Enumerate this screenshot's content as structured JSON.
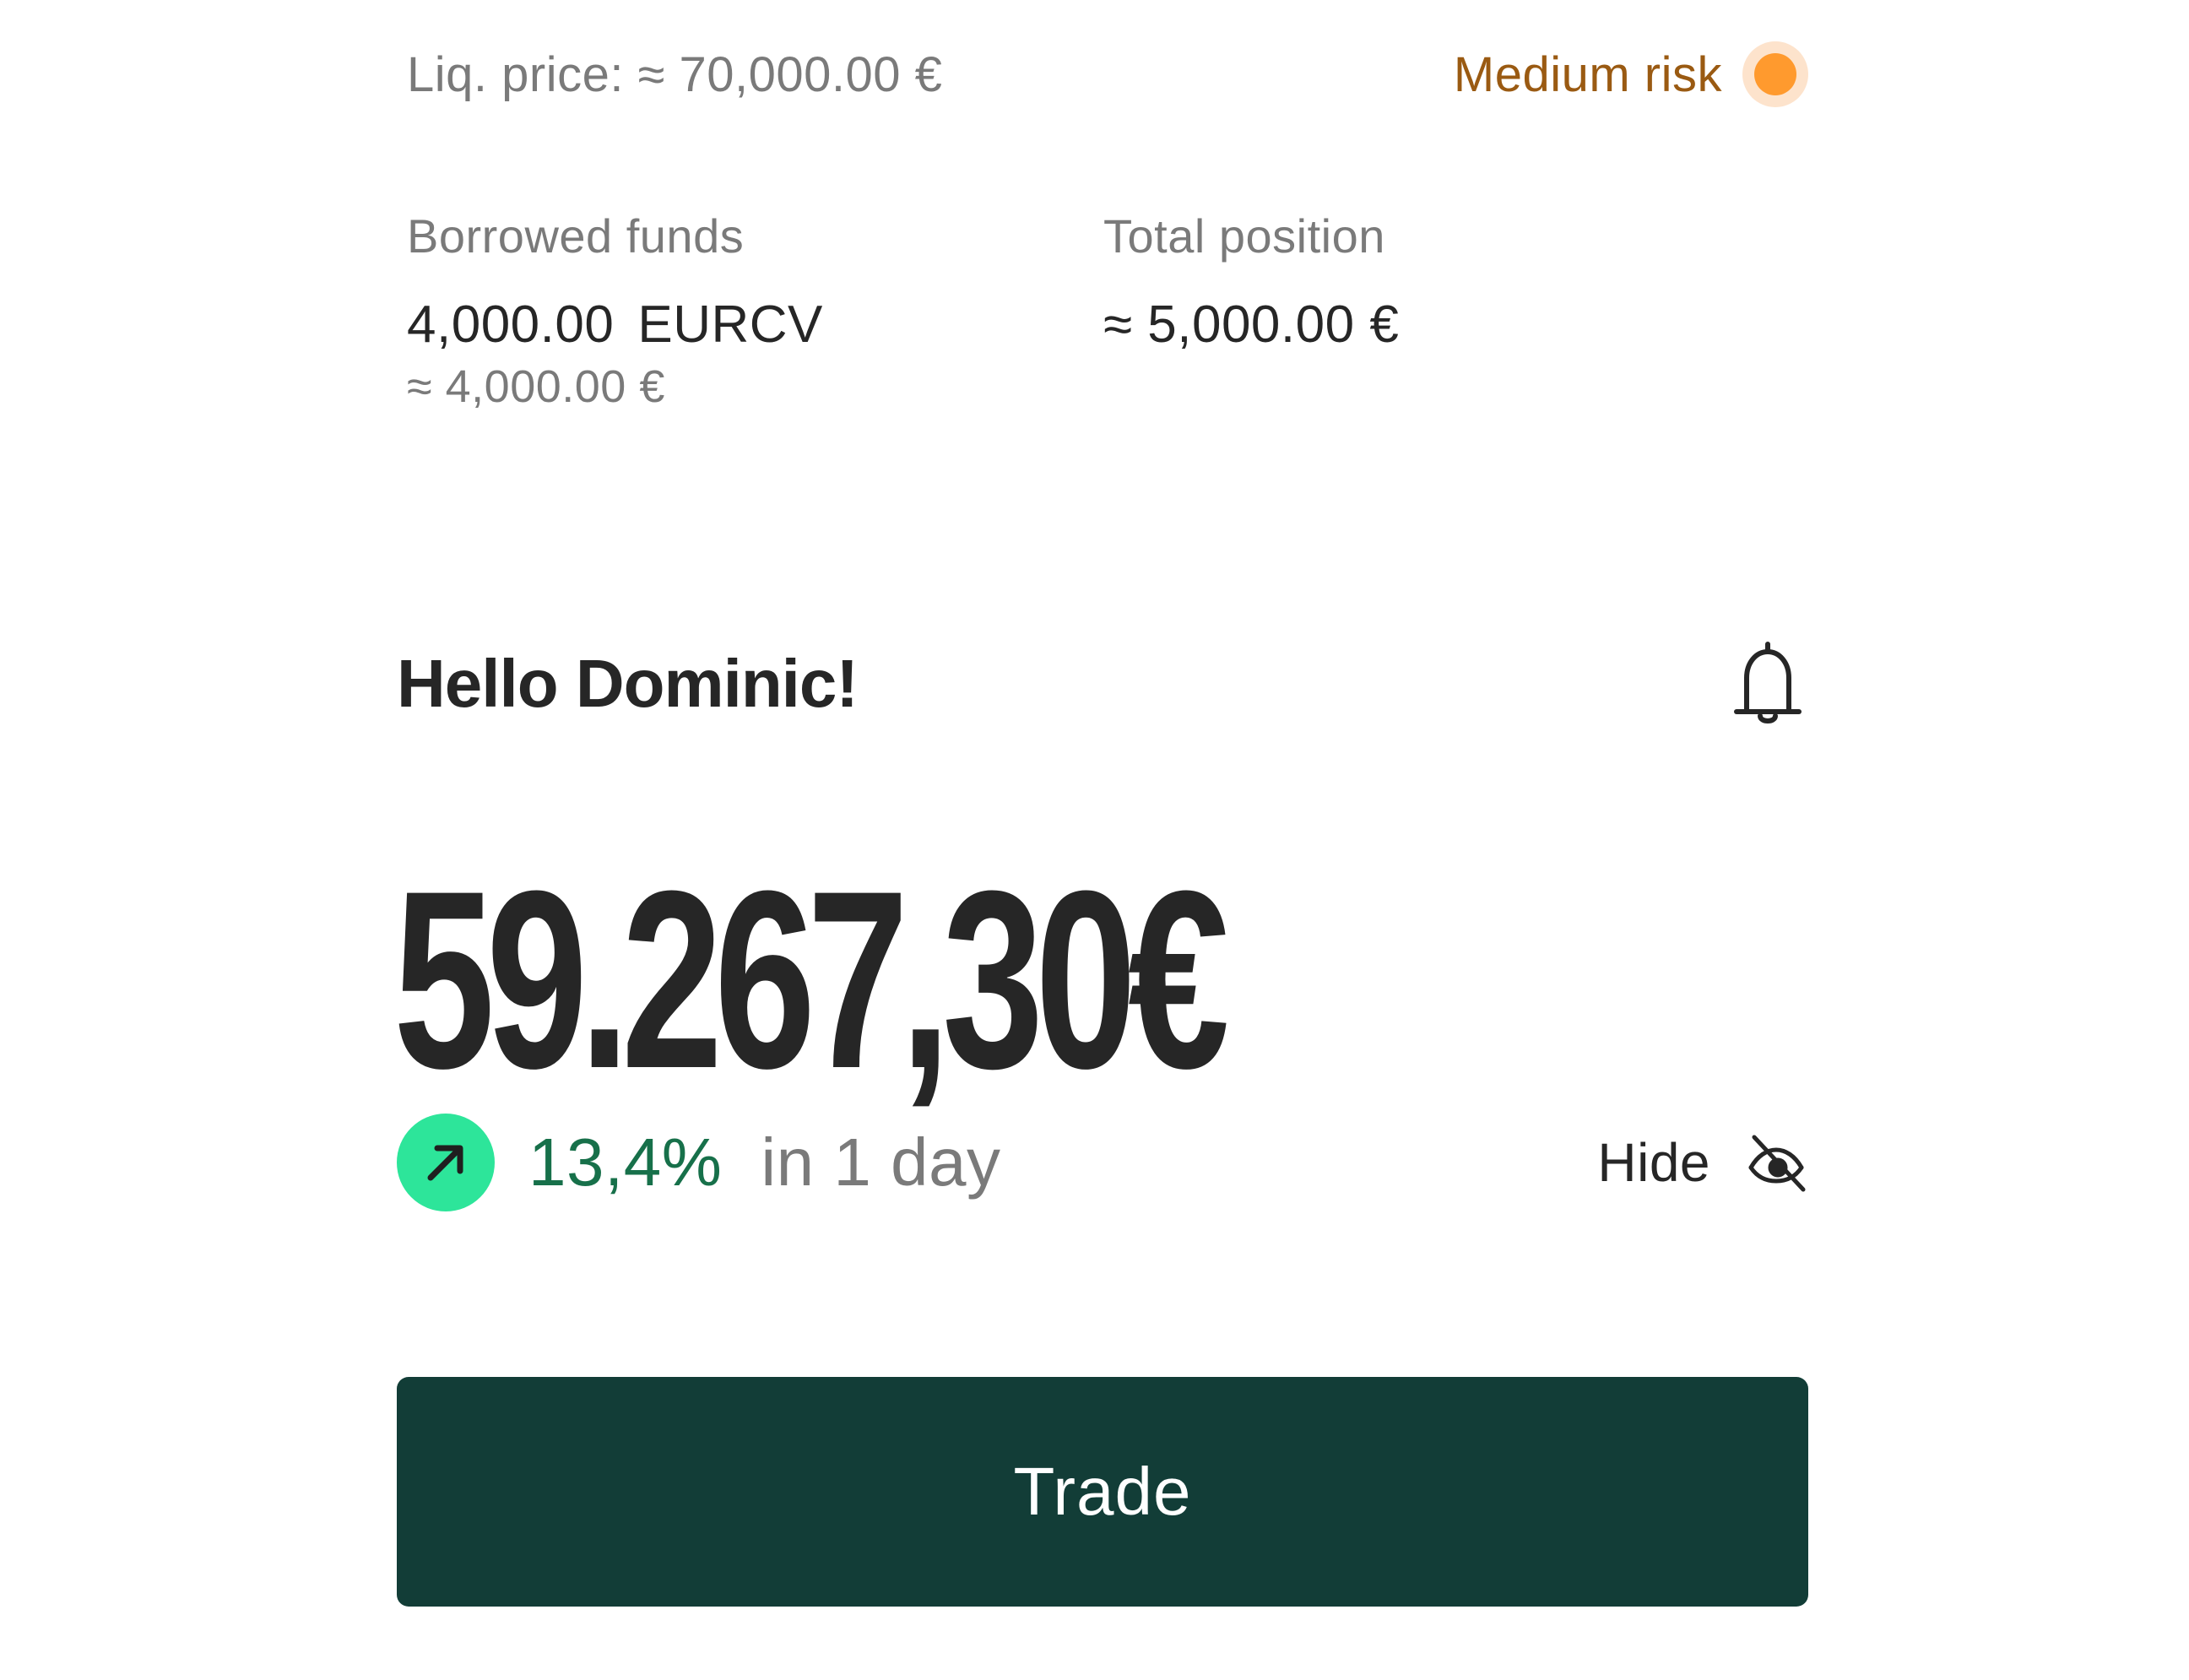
{
  "liquidation": {
    "label": "Liq. price: ≈ 70,000.00 €",
    "risk_label": "Medium risk",
    "risk_color": "#ff9a2e"
  },
  "borrowed": {
    "label": "Borrowed funds",
    "amount": "4,000.00",
    "unit": "EURCV",
    "approx": "≈ 4,000.00 €"
  },
  "total": {
    "label": "Total position",
    "value": "≈ 5,000.00 €"
  },
  "greeting": "Hello Dominic!",
  "balance": "59.267,30€",
  "change": {
    "percent": "13,4%",
    "period": "in 1 day",
    "direction_icon": "arrow-up-right-icon",
    "positive_color": "#17704a"
  },
  "hide": {
    "label": "Hide",
    "icon": "eye-off-icon"
  },
  "trade_button": {
    "label": "Trade",
    "color": "#123d37"
  }
}
